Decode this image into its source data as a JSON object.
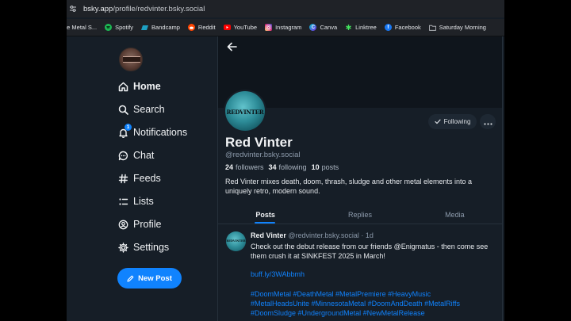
{
  "browser": {
    "url_host": "bsky.app",
    "url_path": "/profile/redvinter.bsky.social",
    "bookmarks": [
      {
        "label": "tte Metal S...",
        "icon": "globe-icon",
        "color": "#5f6368"
      },
      {
        "label": "Spotify",
        "icon": "spotify-icon",
        "color": "#1db954"
      },
      {
        "label": "Bandcamp",
        "icon": "bandcamp-icon",
        "color": "#1da0c3"
      },
      {
        "label": "Reddit",
        "icon": "reddit-icon",
        "color": "#ff4500"
      },
      {
        "label": "YouTube",
        "icon": "youtube-icon",
        "color": "#ff0000"
      },
      {
        "label": "Instagram",
        "icon": "instagram-icon",
        "color": "#d62976"
      },
      {
        "label": "Canva",
        "icon": "canva-icon",
        "color": "#00c4cc"
      },
      {
        "label": "Linktree",
        "icon": "linktree-icon",
        "color": "#43e55e"
      },
      {
        "label": "Facebook",
        "icon": "facebook-icon",
        "color": "#1877f2"
      },
      {
        "label": "Saturday Morning",
        "icon": "folder-icon",
        "color": "#9aa0a6"
      }
    ]
  },
  "nav": {
    "items": [
      {
        "label": "Home",
        "icon": "home-icon"
      },
      {
        "label": "Search",
        "icon": "search-icon"
      },
      {
        "label": "Notifications",
        "icon": "bell-icon",
        "badge": "1"
      },
      {
        "label": "Chat",
        "icon": "chat-icon"
      },
      {
        "label": "Feeds",
        "icon": "hash-icon"
      },
      {
        "label": "Lists",
        "icon": "list-icon"
      },
      {
        "label": "Profile",
        "icon": "user-icon"
      },
      {
        "label": "Settings",
        "icon": "gear-icon"
      }
    ],
    "new_post": "New Post"
  },
  "profile": {
    "avatar_text": "REDVINTER",
    "following_label": "Following",
    "display_name": "Red Vinter",
    "handle": "@redvinter.bsky.social",
    "followers_count": "24",
    "followers_label": "followers",
    "following_count": "34",
    "following_text": "following",
    "posts_count": "10",
    "posts_label": "posts",
    "bio": "Red Vinter mixes death, doom, thrash, sludge and other metal elements into a uniquely retro, modern sound."
  },
  "tabs": [
    "Posts",
    "Replies",
    "Media"
  ],
  "post": {
    "author": "Red Vinter",
    "handle": "@redvinter.bsky.social",
    "age": "· 1d",
    "body": "Check out the debut release from our friends @Enigmatus - then come see them crush it at SINKFEST 2025 in March!",
    "link": "buff.ly/3WAbbmh",
    "tags_line1": "#DoomMetal #DeathMetal #MetalPremiere #HeavyMusic",
    "tags_line2": "#MetalHeadsUnite #MinnesotaMetal #DoomAndDeath  #MetalRiffs",
    "tags_line3": "#DoomSludge #UndergroundMetal #NewMetalRelease"
  },
  "colors": {
    "accent": "#1083fe",
    "background": "#161e27",
    "muted_text": "#8c9aab"
  }
}
